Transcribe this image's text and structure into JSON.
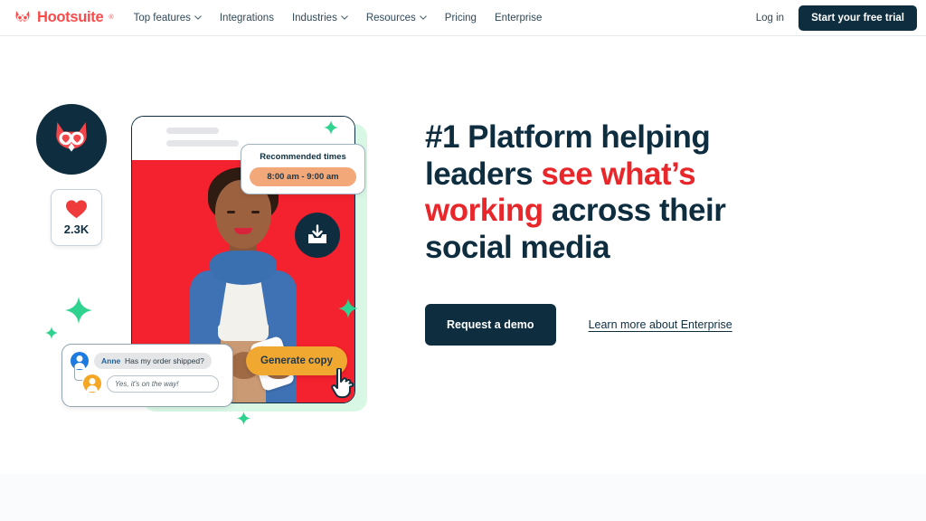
{
  "nav": {
    "brand": {
      "name": "Hootsuite",
      "tm": "®",
      "icon": "hootsuite-owl-logo-icon"
    },
    "links": [
      {
        "label": "Top features",
        "has_chevron": true
      },
      {
        "label": "Integrations",
        "has_chevron": false
      },
      {
        "label": "Industries",
        "has_chevron": true
      },
      {
        "label": "Resources",
        "has_chevron": true
      },
      {
        "label": "Pricing",
        "has_chevron": false
      },
      {
        "label": "Enterprise",
        "has_chevron": false
      }
    ],
    "login_label": "Log in",
    "trial_label": "Start your free trial"
  },
  "hero": {
    "headline": {
      "line1": "#1 Platform helping",
      "line2_plain": "leaders ",
      "line2_accent": "see what’s",
      "line3_accent": "working",
      "line3_plain": " across their",
      "line4": "social media"
    },
    "demo_button": "Request a demo",
    "learn_link": "Learn more about Enterprise"
  },
  "illustration": {
    "owl_badge_icon": "hootsuite-owl-avatar-icon",
    "like_card": {
      "icon": "heart-icon",
      "count": "2.3K"
    },
    "recommended": {
      "title": "Recommended times",
      "slot": "8:00 am - 9:00 am"
    },
    "inbox_icon": "inbox-download-icon",
    "chat": {
      "sender_name": "Anne",
      "message": "Has my order shipped?",
      "reply": "Yes, it’s on the way!",
      "sender_avatar": "user-avatar-blue-icon",
      "reply_avatar": "user-avatar-orange-icon"
    },
    "generate_button": "Generate copy",
    "cursor_icon": "hand-pointer-cursor-icon",
    "sparkle_icon": "sparkle-icon",
    "photo_alt": "woman-using-smartphone-photo"
  },
  "colors": {
    "brand_red": "#fa4a4a",
    "accent_red": "#e8272b",
    "navy": "#0e2e40",
    "green": "#2fd38f",
    "green_light": "#d9f7e5",
    "yellow": "#f0a830",
    "peach": "#f2a878",
    "photo_bg": "#f4212e"
  }
}
